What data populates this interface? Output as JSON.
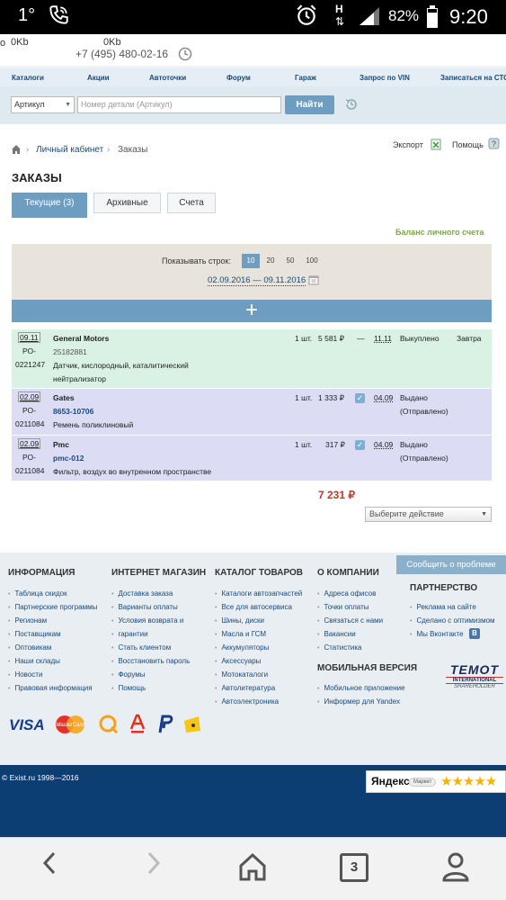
{
  "status": {
    "left_text": "1°",
    "battery": "82%",
    "time": "9:20",
    "signal_letter": "H"
  },
  "header": {
    "traffic_left": "0Kb",
    "traffic_right": "0Kb",
    "phone": "+7 (495) 480-02-16"
  },
  "nav": {
    "items": [
      "Каталоги",
      "Акции",
      "Автоточки",
      "Форум",
      "Гараж",
      "Запрос по VIN",
      "Записаться на СТО"
    ]
  },
  "search": {
    "type_value": "Артикул",
    "placeholder": "Номер детали (Артикул)",
    "button": "Найти"
  },
  "breadcrumb": {
    "cabinet": "Личный кабинет",
    "sep": "›",
    "current": "Заказы"
  },
  "actions": {
    "export": "Экспорт",
    "help": "Помощь"
  },
  "page_title": "ЗАКАЗЫ",
  "tabs": [
    "Текущие (3)",
    "Архивные",
    "Счета"
  ],
  "balance_link": "Баланс личного счета",
  "filters": {
    "rows_label": "Показывать строк:",
    "rows_options": [
      "10",
      "20",
      "50",
      "100"
    ],
    "rows_selected": "10",
    "date_range": "02.09.2016 — 09.11.2016"
  },
  "add_symbol": "+",
  "orders": [
    {
      "date": "09.11",
      "num1": "РО-",
      "num2": "0221247",
      "brand": "General Motors",
      "article": "25182881",
      "desc1": "Датчик, кислородный, каталитический",
      "desc2": "нейтрализатор",
      "qty": "1 шт.",
      "price": "5 581 ₽",
      "mark": "—",
      "due": "11.11",
      "status1": "Выкуплено",
      "status2": "",
      "extra": "Завтра",
      "bg": "#d9f2e4"
    },
    {
      "date": "02.09",
      "num1": "РО-",
      "num2": "0211084",
      "brand": "Gates",
      "article": "8653-10706",
      "desc1": "Ремень поликлиновый",
      "desc2": "",
      "qty": "1 шт.",
      "price": "1 333 ₽",
      "mark": "✓",
      "due": "04.09",
      "status1": "Выдано",
      "status2": "(Отправлено)",
      "extra": "",
      "bg": "#dcdcf5"
    },
    {
      "date": "02.09",
      "num1": "РО-",
      "num2": "0211084",
      "brand": "Pmc",
      "article": "pmc-012",
      "desc1": "Фильтр, воздух во внутренном пространстве",
      "desc2": "",
      "qty": "1 шт.",
      "price": "317 ₽",
      "mark": "✓",
      "due": "04.09",
      "status1": "Выдано",
      "status2": "(Отправлено)",
      "extra": "",
      "bg": "#dcdcf5"
    }
  ],
  "total": "7 231 ₽",
  "action_select": "Выберите действие",
  "footer": {
    "report_button": "Сообщить о проблеме",
    "info": {
      "title": "ИНФОРМАЦИЯ",
      "items": [
        "Таблица скидок",
        "Партнерские программы",
        "Регионам",
        "Поставщикам",
        "Оптовикам",
        "Наши склады",
        "Новости",
        "Правовая информация"
      ]
    },
    "shop": {
      "title": "ИНТЕРНЕТ МАГАЗИН",
      "items": [
        "Доставка заказа",
        "Варианты оплаты",
        "Условия возврата и",
        "гарантии",
        "Стать клиентом",
        "Восстановить пароль",
        "Форумы",
        "Помощь"
      ]
    },
    "catalog": {
      "title": "КАТАЛОГ ТОВАРОВ",
      "items": [
        "Каталоги автозапчастей",
        "Все для автосервиса",
        "Шины, диски",
        "Масла и ГСМ",
        "Аккумуляторы",
        "Аксессуары",
        "Мотокаталоги",
        "Автолитература",
        "Автоэлектроника"
      ]
    },
    "company": {
      "title": "О КОМПАНИИ",
      "items": [
        "Адреса офисов",
        "Точки оплаты",
        "Связаться с нами",
        "Вакансии",
        "Статистика"
      ]
    },
    "partner": {
      "title": "ПАРТНЕРСТВО",
      "items": [
        "Реклама на сайте",
        "Сделано с оптимизмом",
        "Мы Вконтакте"
      ]
    },
    "mobile": {
      "title": "МОБИЛЬНАЯ ВЕРСИЯ",
      "items": [
        "Мобильное приложение",
        "Информер для Yandex"
      ]
    },
    "temot": {
      "line1": "TEMOT",
      "line2": "INTERNATIONAL",
      "line3": "SHAREHOLDER"
    },
    "payments": {
      "visa": "VISA",
      "mastercard": "MasterCard"
    },
    "copyright": "© Exist.ru 1998—2016",
    "yandex": "Яндекс",
    "yandex_market": "Маркет",
    "stars": "★★★★★"
  },
  "navbar": {
    "tabs_count": "3"
  }
}
